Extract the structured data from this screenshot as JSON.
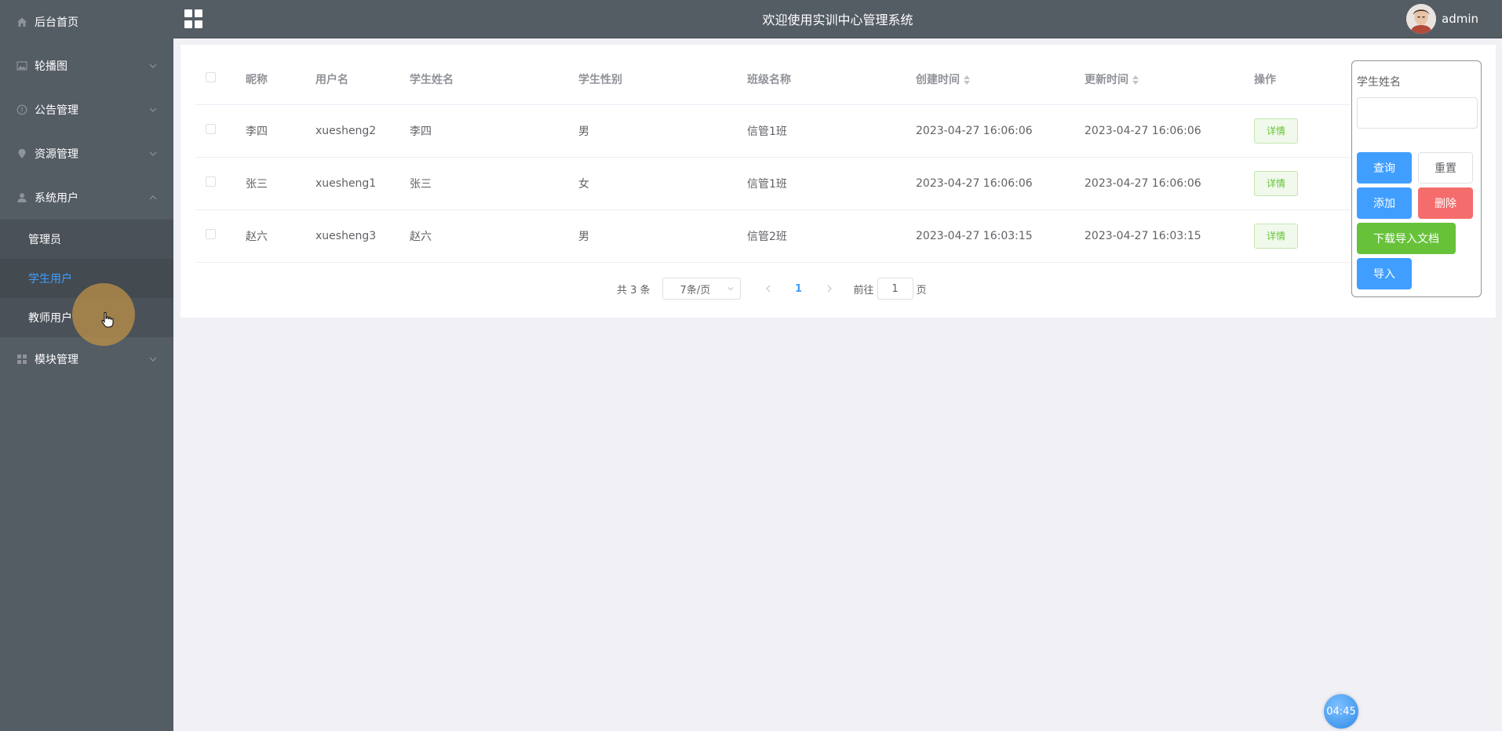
{
  "header": {
    "title": "欢迎使用实训中心管理系统",
    "user_name": "admin"
  },
  "sidebar": {
    "items": [
      {
        "label": "后台首页",
        "icon": "home-icon"
      },
      {
        "label": "轮播图",
        "icon": "image-icon"
      },
      {
        "label": "公告管理",
        "icon": "info-icon"
      },
      {
        "label": "资源管理",
        "icon": "location-icon"
      },
      {
        "label": "系统用户",
        "icon": "user-icon"
      },
      {
        "label": "模块管理",
        "icon": "grid-icon"
      }
    ],
    "submenu": [
      {
        "label": "管理员"
      },
      {
        "label": "学生用户"
      },
      {
        "label": "教师用户"
      }
    ]
  },
  "table": {
    "headers": [
      "昵称",
      "用户名",
      "学生姓名",
      "学生性别",
      "班级名称",
      "创建时间",
      "更新时间",
      "操作"
    ],
    "detail_label": "详情",
    "rows": [
      {
        "nickname": "李四",
        "username": "xuesheng2",
        "name": "李四",
        "gender": "男",
        "class": "信管1班",
        "created": "2023-04-27 16:06:06",
        "updated": "2023-04-27 16:06:06"
      },
      {
        "nickname": "张三",
        "username": "xuesheng1",
        "name": "张三",
        "gender": "女",
        "class": "信管1班",
        "created": "2023-04-27 16:06:06",
        "updated": "2023-04-27 16:06:06"
      },
      {
        "nickname": "赵六",
        "username": "xuesheng3",
        "name": "赵六",
        "gender": "男",
        "class": "信管2班",
        "created": "2023-04-27 16:03:15",
        "updated": "2023-04-27 16:03:15"
      }
    ]
  },
  "pagination": {
    "total": "共 3 条",
    "page_size": "7条/页",
    "current_page": "1",
    "goto_prefix": "前往",
    "goto_value": "1",
    "goto_suffix": "页"
  },
  "search": {
    "label": "学生姓名",
    "query_label": "查询",
    "reset_label": "重置",
    "add_label": "添加",
    "delete_label": "删除",
    "download_label": "下载导入文档",
    "import_label": "导入"
  },
  "timer": "04:45",
  "colors": {
    "sidebar_bg": "#545c64",
    "primary": "#409eff",
    "success": "#67c23a",
    "danger": "#f56c6c"
  }
}
